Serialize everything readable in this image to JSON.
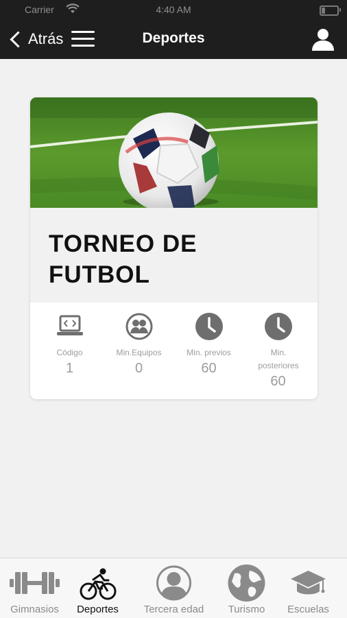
{
  "status_bar": {
    "carrier": "Carrier",
    "time": "4:40 AM"
  },
  "nav": {
    "back_label": "Atrás",
    "title": "Deportes",
    "menu_icon": "hamburger-icon",
    "profile_icon": "user-icon"
  },
  "card": {
    "title": "TORNEO DE FUTBOL",
    "image": "soccer-ball-on-grass",
    "stats": [
      {
        "label": "Código",
        "value": "1",
        "icon": "laptop-code-icon"
      },
      {
        "label": "Min.Equipos",
        "value": "0",
        "icon": "group-icon"
      },
      {
        "label": "Min. previos",
        "value": "60",
        "icon": "clock-icon"
      },
      {
        "label": "Min. posteriores",
        "value": "60",
        "icon": "clock-icon"
      }
    ]
  },
  "tabs": [
    {
      "label": "Gimnasios",
      "icon": "dumbbell-icon",
      "active": false
    },
    {
      "label": "Deportes",
      "icon": "bicycle-icon",
      "active": true
    },
    {
      "label": "Tercera edad",
      "icon": "person-circle-icon",
      "active": false
    },
    {
      "label": "Turismo",
      "icon": "globe-icon",
      "active": false
    },
    {
      "label": "Escuelas",
      "icon": "graduation-cap-icon",
      "active": false
    }
  ],
  "colors": {
    "nav_bg": "#1e1e1e",
    "page_bg": "#f1f1f1",
    "icon_gray": "#6e6e6e",
    "muted_text": "#9c9c9c"
  }
}
